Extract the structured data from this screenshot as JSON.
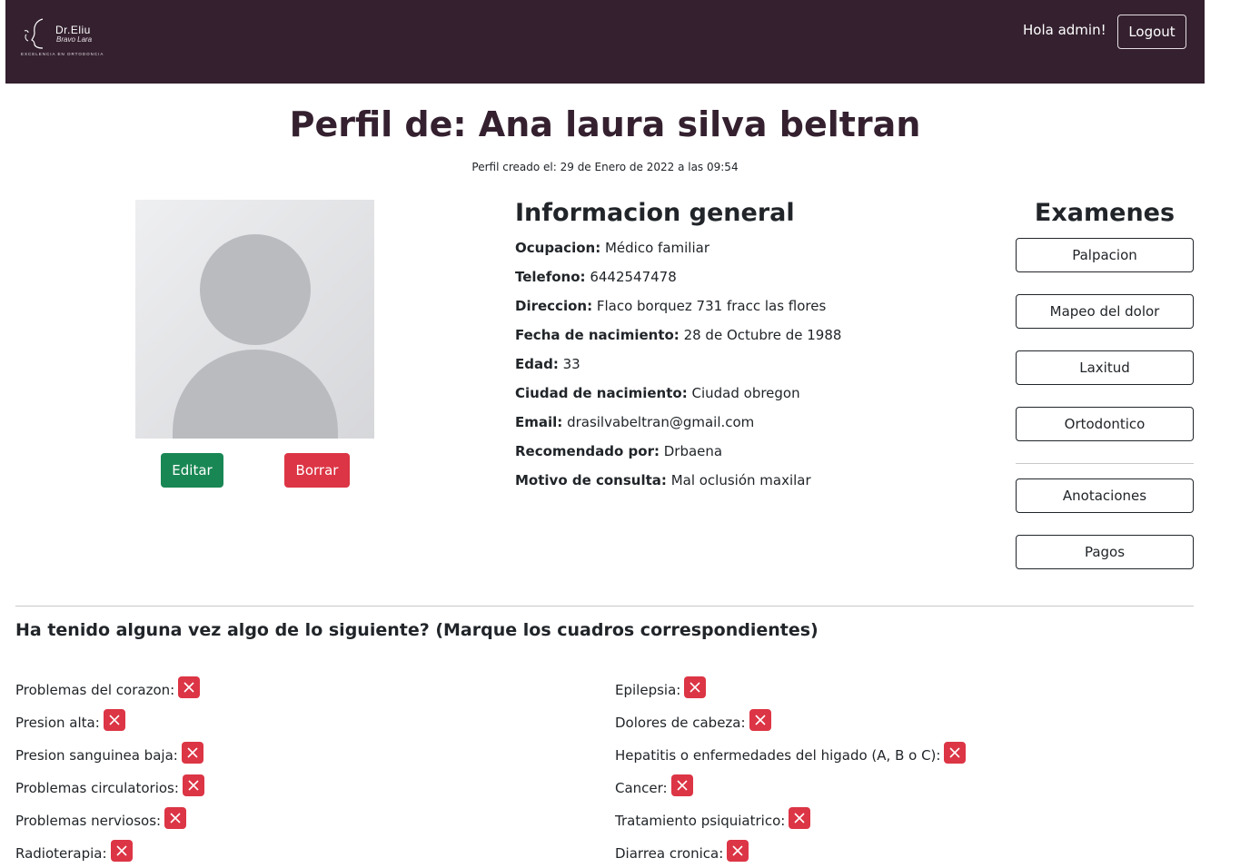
{
  "header": {
    "logo": {
      "title": "Dr.Eliu",
      "subtitle": "Bravo Lara",
      "tagline": "EXCELENCIA EN ORTODONCIA"
    },
    "greeting": "Hola admin!",
    "logout_label": "Logout"
  },
  "profile": {
    "title": "Perfil de: Ana laura silva beltran",
    "created": "Perfil creado el: 29 de Enero de 2022 a las 09:54",
    "edit_label": "Editar",
    "delete_label": "Borrar"
  },
  "info": {
    "title": "Informacion general",
    "fields": [
      {
        "label": "Ocupacion:",
        "value": "Médico familiar"
      },
      {
        "label": "Telefono:",
        "value": "6442547478"
      },
      {
        "label": "Direccion:",
        "value": "Flaco borquez 731 fracc las flores"
      },
      {
        "label": "Fecha de nacimiento:",
        "value": "28 de Octubre de 1988"
      },
      {
        "label": "Edad:",
        "value": "33"
      },
      {
        "label": "Ciudad de nacimiento:",
        "value": "Ciudad obregon"
      },
      {
        "label": "Email:",
        "value": "drasilvabeltran@gmail.com"
      },
      {
        "label": "Recomendado por:",
        "value": "Drbaena"
      },
      {
        "label": "Motivo de consulta:",
        "value": "Mal oclusión maxilar"
      }
    ]
  },
  "exams": {
    "title": "Examenes",
    "buttons": [
      "Palpacion",
      "Mapeo del dolor",
      "Laxitud",
      "Ortodontico",
      "Anotaciones",
      "Pagos"
    ]
  },
  "conditions": {
    "question": "Ha tenido alguna vez algo de lo siguiente? (Marque los cuadros correspondientes)",
    "left": [
      "Problemas del corazon:",
      "Presion alta:",
      "Presion sanguinea baja:",
      "Problemas circulatorios:",
      "Problemas nerviosos:",
      "Radioterapia:"
    ],
    "right": [
      "Epilepsia:",
      "Dolores de cabeza:",
      "Hepatitis o enfermedades del higado (A, B o C):",
      "Cancer:",
      "Tratamiento psiquiatrico:",
      "Diarrea cronica:"
    ]
  },
  "colors": {
    "header_bg": "#34202f",
    "success": "#198754",
    "danger": "#dc3545"
  }
}
